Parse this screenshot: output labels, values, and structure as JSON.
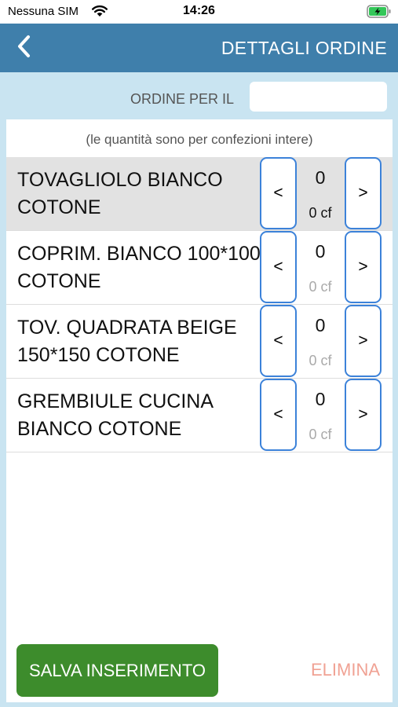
{
  "status_bar": {
    "carrier": "Nessuna SIM",
    "time": "14:26",
    "wifi_icon": "wifi-icon",
    "battery_icon": "battery-charging-icon"
  },
  "nav": {
    "back_icon": "chevron-left-icon",
    "title": "DETTAGLI ORDINE"
  },
  "order_date": {
    "label": "ORDINE PER IL",
    "value": "",
    "placeholder": ""
  },
  "note": "(le quantità sono per confezioni intere)",
  "items": [
    {
      "name": "TOVAGLIOLO BIANCO COTONE",
      "qty": "0",
      "cf": "0 cf",
      "dec_label": "<",
      "inc_label": ">",
      "selected": true
    },
    {
      "name": "COPRIM. BIANCO 100*100 COTONE",
      "qty": "0",
      "cf": "0 cf",
      "dec_label": "<",
      "inc_label": ">",
      "selected": false
    },
    {
      "name": "TOV. QUADRATA BEIGE 150*150 COTONE",
      "qty": "0",
      "cf": "0 cf",
      "dec_label": "<",
      "inc_label": ">",
      "selected": false
    },
    {
      "name": "GREMBIULE CUCINA BIANCO COTONE",
      "qty": "0",
      "cf": "0 cf",
      "dec_label": "<",
      "inc_label": ">",
      "selected": false
    }
  ],
  "actions": {
    "save_label": "SALVA INSERIMENTO",
    "delete_label": "ELIMINA"
  },
  "colors": {
    "nav_background": "#3f7fab",
    "page_background": "#c9e4f1",
    "save_button": "#3d8c2c",
    "delete_text": "#f0a294",
    "stepper_border": "#3c82d9",
    "selected_row": "#e2e2e2"
  }
}
